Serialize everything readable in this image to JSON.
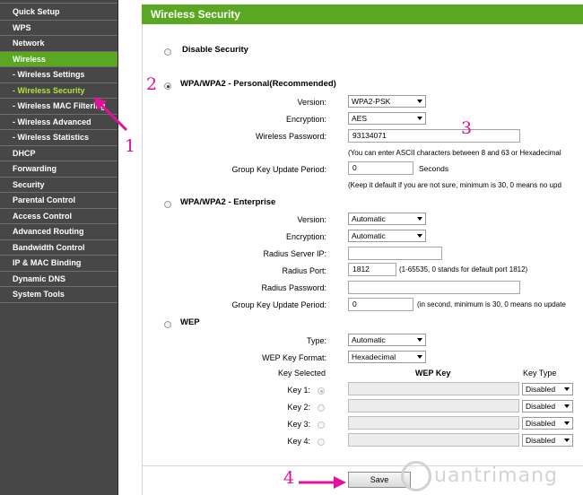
{
  "sidebar": {
    "items": [
      {
        "label": "Quick Setup"
      },
      {
        "label": "WPS"
      },
      {
        "label": "Network"
      },
      {
        "label": "Wireless"
      },
      {
        "label": "- Wireless Settings"
      },
      {
        "label": "- Wireless Security"
      },
      {
        "label": "- Wireless MAC Filtering"
      },
      {
        "label": "- Wireless Advanced"
      },
      {
        "label": "- Wireless Statistics"
      },
      {
        "label": "DHCP"
      },
      {
        "label": "Forwarding"
      },
      {
        "label": "Security"
      },
      {
        "label": "Parental Control"
      },
      {
        "label": "Access Control"
      },
      {
        "label": "Advanced Routing"
      },
      {
        "label": "Bandwidth Control"
      },
      {
        "label": "IP & MAC Binding"
      },
      {
        "label": "Dynamic DNS"
      },
      {
        "label": "System Tools"
      }
    ],
    "active_item": "Wireless",
    "current_item": "- Wireless Security"
  },
  "header": {
    "title": "Wireless Security"
  },
  "disable_security": {
    "label": "Disable Security"
  },
  "personal": {
    "title": "WPA/WPA2 - Personal(Recommended)",
    "version_label": "Version:",
    "version_value": "WPA2-PSK",
    "encryption_label": "Encryption:",
    "encryption_value": "AES",
    "password_label": "Wireless Password:",
    "password_value": "93134071",
    "password_note": "(You can enter ASCII characters between 8 and 63 or Hexadecimal",
    "group_key_label": "Group Key Update Period:",
    "group_key_value": "0",
    "group_key_unit": "Seconds",
    "group_key_note": "(Keep it default if you are not sure, minimum is 30, 0 means no upd"
  },
  "enterprise": {
    "title": "WPA/WPA2 - Enterprise",
    "version_label": "Version:",
    "version_value": "Automatic",
    "encryption_label": "Encryption:",
    "encryption_value": "Automatic",
    "radius_ip_label": "Radius Server IP:",
    "radius_ip_value": "",
    "radius_port_label": "Radius Port:",
    "radius_port_value": "1812",
    "radius_port_note": "(1-65535, 0 stands for default port 1812)",
    "radius_password_label": "Radius Password:",
    "radius_password_value": "",
    "group_key_label": "Group Key Update Period:",
    "group_key_value": "0",
    "group_key_note": "(in second, minimum is 30, 0 means no update"
  },
  "wep": {
    "title": "WEP",
    "type_label": "Type:",
    "type_value": "Automatic",
    "key_format_label": "WEP Key Format:",
    "key_format_value": "Hexadecimal",
    "col_key_selected": "Key Selected",
    "col_wep_key": "WEP Key",
    "col_key_type": "Key Type",
    "keys": [
      {
        "label": "Key 1:",
        "type": "Disabled"
      },
      {
        "label": "Key 2:",
        "type": "Disabled"
      },
      {
        "label": "Key 3:",
        "type": "Disabled"
      },
      {
        "label": "Key 4:",
        "type": "Disabled"
      }
    ]
  },
  "save_label": "Save",
  "annotations": {
    "a1": "1",
    "a2": "2",
    "a3": "3",
    "a4": "4"
  },
  "watermark": {
    "text": "uantrimang"
  },
  "colors": {
    "sidebar_bg": "#474747",
    "accent_green": "#5aa821",
    "current_text": "#b5e33d",
    "annotation": "#e0119c"
  }
}
